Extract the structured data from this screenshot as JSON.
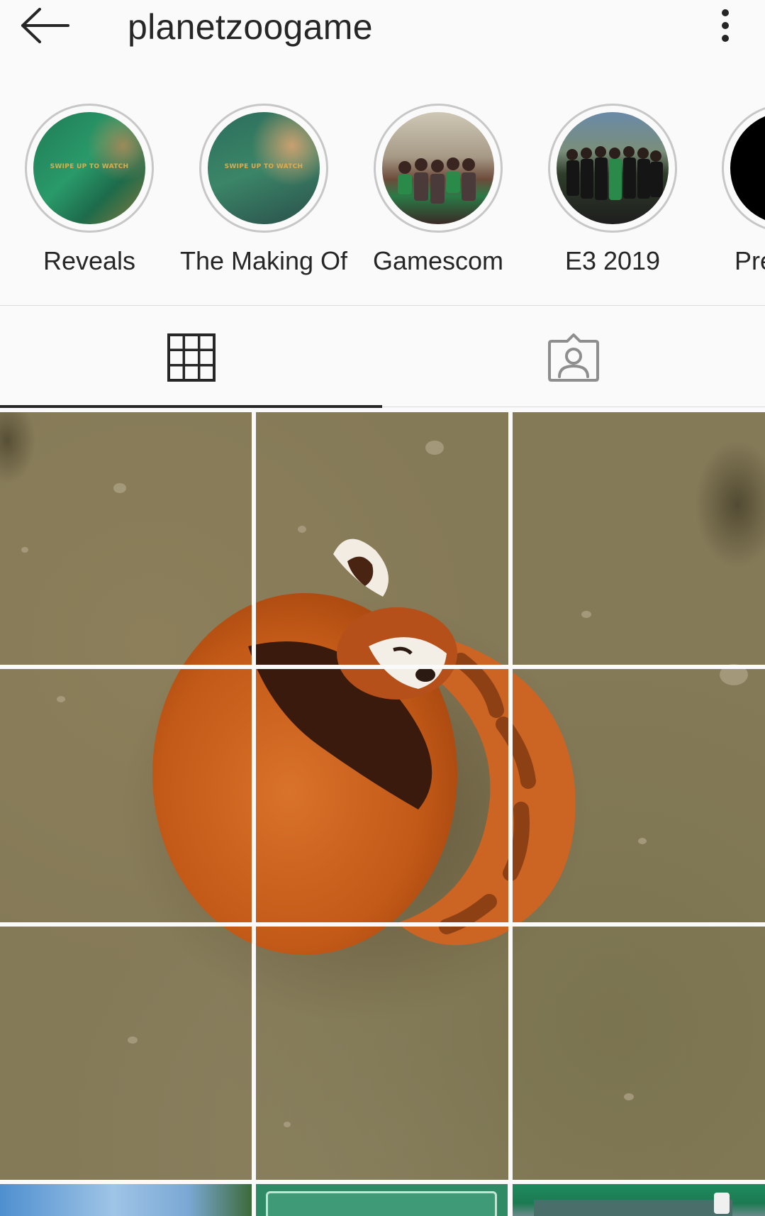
{
  "header": {
    "username": "planetzoogame"
  },
  "highlights": [
    {
      "label": "Reveals",
      "overlay_text": "SWIPE UP TO WATCH"
    },
    {
      "label": "The Making Of",
      "overlay_text": "SWIPE UP TO WATCH"
    },
    {
      "label": "Gamescom"
    },
    {
      "label": "E3 2019"
    },
    {
      "label": "Pre"
    }
  ],
  "tabs": [
    {
      "icon": "grid-icon",
      "active": true
    },
    {
      "icon": "tagged-icon",
      "active": false
    }
  ],
  "colors": {
    "background": "#fafafa",
    "text": "#262626",
    "divider": "#dbdbdb",
    "ring": "#c7c7c7",
    "ground": "#857a58",
    "red_panda": "#c65a1e",
    "highlight_green": "#1e8a5a"
  },
  "post_grid": {
    "columns": 3,
    "description_hidden": true
  }
}
